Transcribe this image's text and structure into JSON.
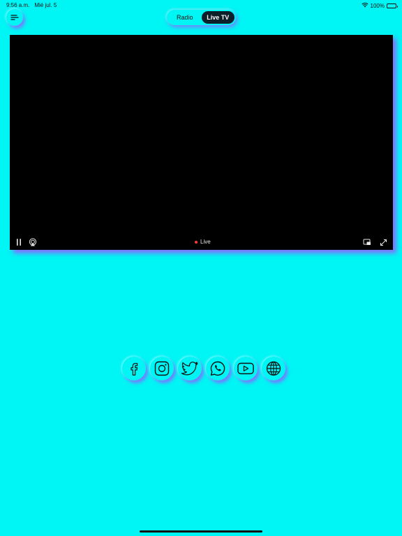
{
  "status_bar": {
    "time": "9:56 a.m.",
    "date": "Mié jul. 5",
    "battery": "100%",
    "battery_level": 1.0,
    "wifi_icon": "wifi-icon",
    "battery_icon": "battery-icon"
  },
  "header": {
    "menu_icon": "menu-icon",
    "tabs": [
      {
        "label": "Radio",
        "active": false
      },
      {
        "label": "Live TV",
        "active": true
      }
    ]
  },
  "player": {
    "live_label": "Live",
    "controls": [
      "pause-icon",
      "airplay-icon",
      "pip-icon",
      "fullscreen-icon"
    ]
  },
  "social": [
    {
      "name": "facebook-icon"
    },
    {
      "name": "instagram-icon"
    },
    {
      "name": "twitter-icon"
    },
    {
      "name": "whatsapp-icon"
    },
    {
      "name": "youtube-icon"
    },
    {
      "name": "globe-icon"
    }
  ],
  "colors": {
    "background": "#00f5f5",
    "shadow": "#965aff",
    "active_tab": "#0c1f2a",
    "live_dot": "#ff3b30"
  }
}
